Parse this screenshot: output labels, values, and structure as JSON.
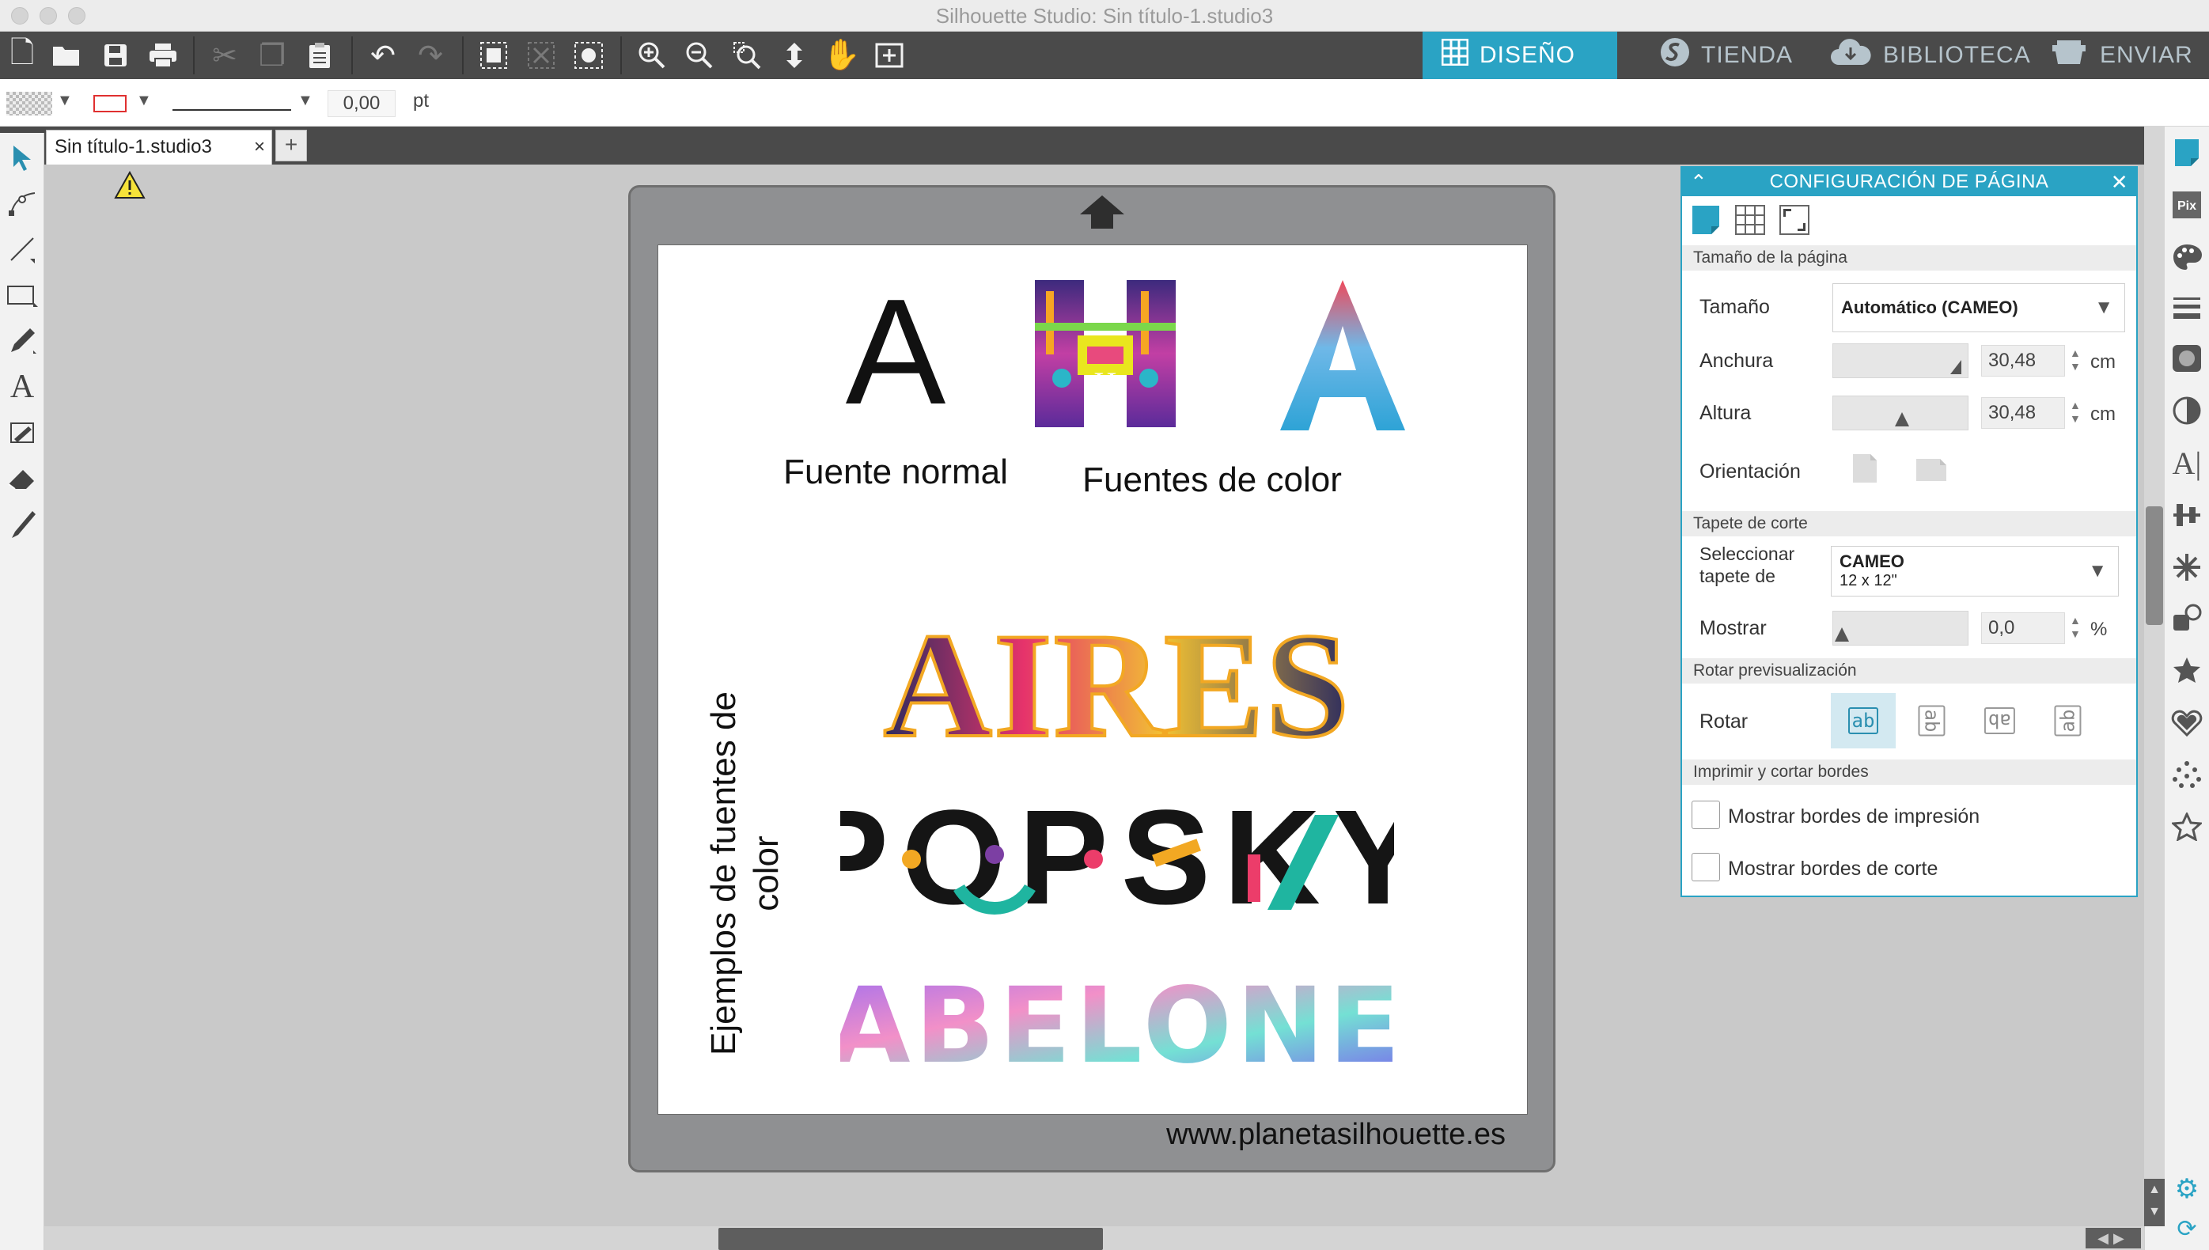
{
  "window": {
    "title": "Silhouette Studio: Sin título-1.studio3"
  },
  "toolbar": {
    "icons": [
      "new-file-icon",
      "open-folder-icon",
      "save-icon",
      "print-icon",
      "cut-icon",
      "copy-icon",
      "paste-icon",
      "undo-icon",
      "redo-icon",
      "group-icon",
      "ungroup-icon",
      "select-all-icon",
      "zoom-in-icon",
      "zoom-out-icon",
      "zoom-select-icon",
      "fit-page-icon",
      "pan-icon",
      "add-page-icon"
    ],
    "nav_tabs": [
      {
        "label": "DISEÑO",
        "icon": "grid-icon",
        "active": true
      },
      {
        "label": "TIENDA",
        "icon": "store-icon",
        "active": false
      },
      {
        "label": "BIBLIOTECA",
        "icon": "cloud-library-icon",
        "active": false
      },
      {
        "label": "ENVIAR",
        "icon": "send-icon",
        "active": false
      }
    ],
    "accent_color": "#2aa3c4"
  },
  "properties": {
    "line_width": "0,00",
    "line_unit": "pt",
    "line_color": "#e03030"
  },
  "document": {
    "tab_label": "Sin título-1.studio3",
    "tab_close": "×",
    "add_tab": "+"
  },
  "design": {
    "glyph_normal": "A",
    "label_normal": "Fuente normal",
    "label_color": "Fuentes de color",
    "vertical_label": "Ejemplos de fuentes de color",
    "word_1": "AIRES",
    "word_2": "POPSKY",
    "word_3": "ABELONE",
    "color_glyph_1": "H",
    "color_glyph_2": "A",
    "website": "www.planetasilhouette.es"
  },
  "page_panel": {
    "title": "CONFIGURACIÓN DE PÁGINA",
    "section_size": "Tamaño de la página",
    "size_label": "Tamaño",
    "size_value": "Automático (CAMEO)",
    "width_label": "Anchura",
    "width_value": "30,48",
    "height_label": "Altura",
    "height_value": "30,48",
    "unit": "cm",
    "orientation_label": "Orientación",
    "section_mat": "Tapete de corte",
    "mat_label": "Seleccionar tapete de corte",
    "mat_value": "CAMEO",
    "mat_size": "12 x 12\"",
    "show_label": "Mostrar",
    "show_value": "0,0",
    "show_unit": "%",
    "section_rotate": "Rotar previsualización",
    "rotate_label": "Rotar",
    "rotate_glyph": "ab",
    "section_borders": "Imprimir y cortar bordes",
    "print_borders_label": "Mostrar bordes de impresión",
    "cut_borders_label": "Mostrar bordes de corte",
    "print_borders_checked": false,
    "cut_borders_checked": false
  }
}
